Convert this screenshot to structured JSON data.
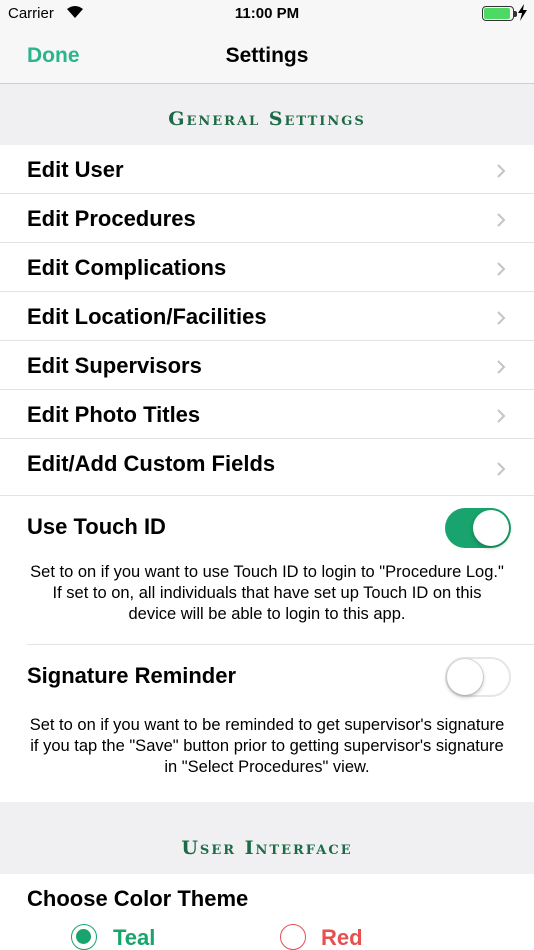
{
  "status": {
    "carrier": "Carrier",
    "time": "11:00 PM"
  },
  "nav": {
    "done": "Done",
    "title": "Settings"
  },
  "general": {
    "header": "General Settings",
    "items": [
      {
        "label": "Edit User"
      },
      {
        "label": "Edit Procedures"
      },
      {
        "label": "Edit Complications"
      },
      {
        "label": "Edit Location/Facilities"
      },
      {
        "label": "Edit Supervisors"
      },
      {
        "label": "Edit Photo Titles"
      },
      {
        "label": "Edit/Add Custom Fields"
      }
    ],
    "touch_id": {
      "label": "Use Touch ID",
      "on": true,
      "description": "Set to on if you want to use Touch ID to login to \"Procedure Log.\"  If set to on, all individuals that have set up Touch ID on this device will be able to login to this app."
    },
    "signature_reminder": {
      "label": "Signature Reminder",
      "on": false,
      "description": "Set to on if you want to be reminded to get supervisor's signature if you tap the \"Save\" button prior to getting supervisor's signature in \"Select Procedures\" view."
    }
  },
  "ui": {
    "header": "User Interface",
    "color_theme_label": "Choose Color Theme",
    "themes": [
      {
        "label": "Teal",
        "selected": true,
        "color": "#18a46c"
      },
      {
        "label": "Red",
        "selected": false,
        "color": "#e55050"
      }
    ]
  },
  "colors": {
    "accent": "#2ab58b",
    "toggle_on": "#18a46c",
    "header_text": "#1d6b46"
  }
}
